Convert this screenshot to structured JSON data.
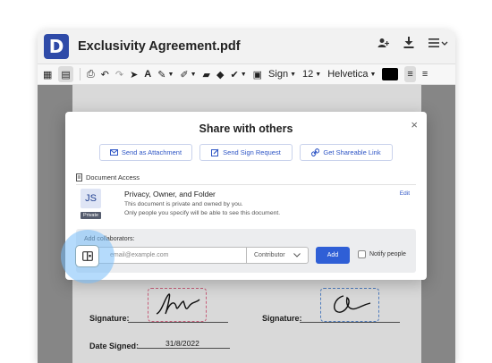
{
  "app": {
    "logo_letter": "D",
    "document_title": "Exclusivity Agreement.pdf",
    "brand_color": "#2f4ba8"
  },
  "title_actions": [
    {
      "icon": "add-user-icon"
    },
    {
      "icon": "download-icon"
    },
    {
      "icon": "menu-icon"
    }
  ],
  "toolbar": {
    "sign_label": "Sign",
    "font_size": "12",
    "font_family": "Helvetica",
    "text_color": "#000000"
  },
  "document": {
    "signature_label_1": "Signature:",
    "signature_label_2": "Signature:",
    "date_signed_label": "Date Signed:",
    "date_signed_value": "31/8/2022"
  },
  "modal": {
    "title": "Share with others",
    "close_symbol": "×",
    "buttons": {
      "send_attachment": "Send as Attachment",
      "send_sign_request": "Send Sign Request",
      "get_link": "Get Shareable Link"
    },
    "section_label": "Document Access",
    "owner": {
      "initials": "JS",
      "badge": "Private",
      "title": "Privacy, Owner, and Folder",
      "desc_line1": "This document is private and owned by you.",
      "desc_line2": "Only people you specify will be able to see this document.",
      "edit_label": "Edit"
    },
    "collaborators": {
      "label": "Add collaborators:",
      "email_placeholder": "email@example.com",
      "role_value": "Contributor",
      "add_label": "Add",
      "notify_label": "Notify people"
    },
    "accent_color": "#2f5fd6"
  }
}
